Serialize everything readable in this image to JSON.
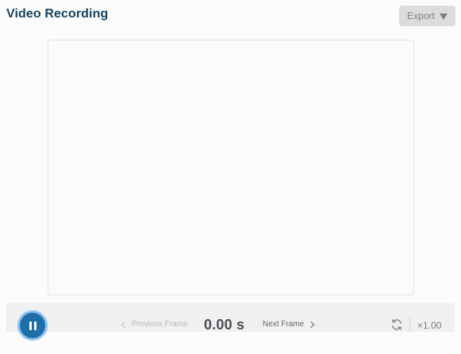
{
  "header": {
    "title": "Video Recording",
    "export_label": "Export",
    "export_icon": "caret-down-icon"
  },
  "player": {
    "prev_frame_label": "Previous Frame",
    "next_frame_label": "Next Frame",
    "time": "0.00 s",
    "speed": "×1.00",
    "play_state_icon": "pause-icon",
    "reset_icon": "refresh-icon"
  },
  "colors": {
    "title": "#16435e",
    "accent": "#1e6fa8",
    "accent_ring": "#8fc1ec",
    "export_bg": "#dcdcdc",
    "controls_bg": "#f0f0f0"
  }
}
